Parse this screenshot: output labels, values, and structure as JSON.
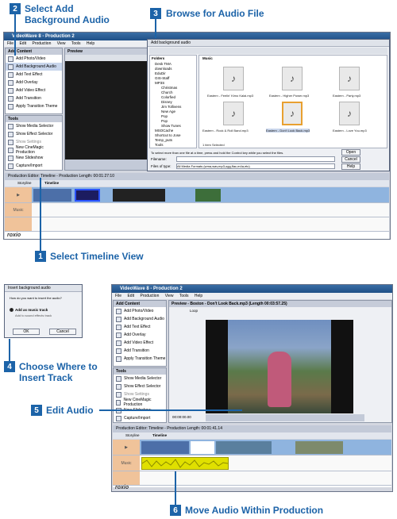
{
  "callouts": {
    "c1": {
      "num": "1",
      "text": "Select Timeline View"
    },
    "c2": {
      "num": "2",
      "text_line1": "Select Add",
      "text_line2": "Background Audio"
    },
    "c3": {
      "num": "3",
      "text": "Browse for Audio File"
    },
    "c4": {
      "num": "4",
      "text_line1": "Choose Where to",
      "text_line2": "Insert Track"
    },
    "c5": {
      "num": "5",
      "text": "Edit Audio"
    },
    "c6": {
      "num": "6",
      "text": "Move Audio Within Production"
    }
  },
  "app": {
    "title": "VideoWave 8 - Production 2",
    "menu": [
      "File",
      "Edit",
      "Production",
      "View",
      "Tools",
      "Help"
    ],
    "add_content_head": "Add Content",
    "add_content_items": [
      "Add Photo/Video",
      "Add Background Audio",
      "Add Text Effect",
      "Add Overlay",
      "Add Video Effect",
      "Add Transition",
      "Apply Transition Theme"
    ],
    "tools_head": "Tools",
    "tools_items": [
      "Show Media Selector",
      "Show Effect Selector",
      "Show Settings",
      "New CineMagic Production",
      "New Slideshow",
      "Capture/Import"
    ],
    "preview_head": "Preview",
    "timeline_bar": "Production Editor: Timeline - Production Length: 00:01:27:10",
    "storyline_tab": "Storyline",
    "timeline_tab": "Timeline",
    "music_label": "Music",
    "logo": "roxio"
  },
  "browse_dialog": {
    "title": "Add background audio",
    "folders_head": "Folders",
    "folders": [
      "Desk TMA",
      "downloads",
      "EduDir",
      "GIS-Staff",
      "MP3S",
      "Christmas",
      "Church",
      "Colorfied",
      "Disney",
      "Jim Tollivens",
      "New Age",
      "Pop",
      "Pop",
      "Show Tunes",
      "MSOCache",
      "Shortcut to Jose",
      "Temp_puts",
      "Tools"
    ],
    "path_label": "Music",
    "files": [
      "Eastern - Feelin' Kimo Kalai.mp3",
      "Eastern - Higher Power.mp3",
      "Eastern - Party.mp3",
      "Eastern - Rock & Roll Band.mp3",
      "Eastern - Don't Look Back.mp3",
      "Eastern - Love You.mp3"
    ],
    "status": "1 item Selected",
    "hint": "To select more than one file at a time, press and hold the Control key while you select the files.",
    "filename_label": "Filename:",
    "filetype_label": "Files of type:",
    "filetype_value": "All Media Formats (wma,wav,mp3,ogg,flac,m4a,etc)",
    "open_btn": "Open",
    "cancel_btn": "Cancel",
    "help_btn": "Help"
  },
  "insert_dialog": {
    "title": "Insert background audio",
    "question": "How do you want to insert the audio?",
    "option_main": "Add as music track",
    "option_sub": "Add to sound effects track",
    "ok_btn": "OK",
    "cancel_btn": "Cancel"
  },
  "second_app": {
    "title": "VideoWave 8 - Production 2",
    "preview_head": "Preview - Boston - Don't Look Back.mp3 (Length 00:03:57.25)",
    "loop_label": "Loop",
    "timecode": "00:00:00.00",
    "timeline_bar": "Production Editor: Timeline - Production Length: 00:01:41.14"
  },
  "colors": {
    "callout_blue": "#1c63a8",
    "audio_yellow": "#e0e000",
    "track_label": "#f0c39a"
  }
}
